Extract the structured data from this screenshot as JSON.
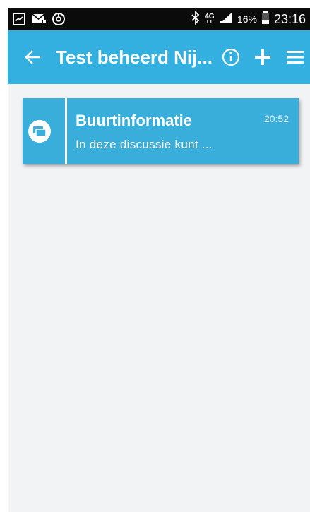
{
  "status_bar": {
    "icons_left": [
      "gallery-icon",
      "mail-icon",
      "sync-icon"
    ],
    "bluetooth": "bluetooth-icon",
    "network_top": "4G",
    "network_bottom": "LT",
    "battery_percent": "16%",
    "time": "23:16"
  },
  "app_bar": {
    "title": "Test beheerd Nij...",
    "back_icon": "arrow-left-icon",
    "info_icon": "info-icon",
    "add_icon": "plus-icon",
    "menu_icon": "menu-icon",
    "color": "#33b0df"
  },
  "conversations": [
    {
      "title": "Buurtinformatie",
      "time": "20:52",
      "preview": "In deze discussie kunt ...",
      "icon": "chat-bubbles-icon"
    }
  ],
  "colors": {
    "accent": "#33b0df",
    "card": "#3aaedb",
    "background": "#f2f3f5"
  }
}
